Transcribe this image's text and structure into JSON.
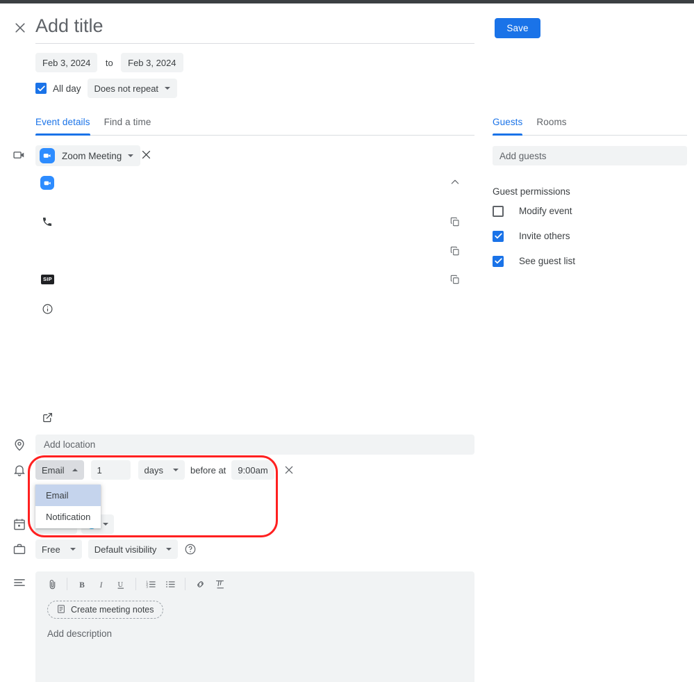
{
  "header": {
    "close_icon": "close-icon",
    "title_placeholder": "Add title",
    "title_value": "",
    "save_label": "Save"
  },
  "schedule": {
    "start_date": "Feb 3, 2024",
    "to_label": "to",
    "end_date": "Feb 3, 2024",
    "all_day_label": "All day",
    "all_day_checked": true,
    "repeat_value": "Does not repeat"
  },
  "tabs": {
    "left": [
      {
        "label": "Event details",
        "active": true
      },
      {
        "label": "Find a time",
        "active": false
      }
    ],
    "right": [
      {
        "label": "Guests",
        "active": true
      },
      {
        "label": "Rooms",
        "active": false
      }
    ]
  },
  "conference": {
    "rail_icon": "video-camera-icon",
    "provider_label": "Zoom Meeting",
    "provider_icon": "zoom-icon",
    "remove_icon": "close-icon",
    "collapse_icon": "chevron-up-icon",
    "rows": [
      {
        "icon": "zoom-icon",
        "text": ""
      },
      {
        "icon": "phone-icon",
        "text": "",
        "copy_icon": "copy-icon"
      },
      {
        "icon": "",
        "text": "",
        "copy_icon": "copy-icon"
      },
      {
        "icon": "sip-icon",
        "badge": "SIP",
        "text": "",
        "copy_icon": "copy-icon"
      },
      {
        "icon": "info-icon",
        "text": ""
      },
      {
        "icon": "external-link-icon",
        "text": ""
      }
    ]
  },
  "location": {
    "rail_icon": "location-pin-icon",
    "placeholder": "Add location",
    "value": ""
  },
  "notification": {
    "rail_icon": "bell-icon",
    "method": "Email",
    "method_caret": "caret-up-icon",
    "amount": "1",
    "unit": "days",
    "before_at_label": "before at",
    "time": "9:00am",
    "remove_icon": "close-icon",
    "dropdown_open": true,
    "dropdown_options": [
      {
        "label": "Email",
        "selected": true
      },
      {
        "label": "Notification",
        "selected": false
      }
    ]
  },
  "calendar_row": {
    "rail_icon": "calendar-icon",
    "calendar_value": "",
    "color_dot": "#039be5"
  },
  "availability": {
    "rail_icon": "briefcase-icon",
    "busy_value": "Free",
    "visibility_value": "Default visibility",
    "help_icon": "help-circle-icon"
  },
  "description": {
    "rail_icon": "description-lines-icon",
    "toolbar": [
      {
        "name": "attach-icon",
        "glyph": "attach"
      },
      {
        "name": "bold-icon",
        "glyph": "B"
      },
      {
        "name": "italic-icon",
        "glyph": "I"
      },
      {
        "name": "underline-icon",
        "glyph": "U"
      },
      {
        "name": "numbered-list-icon",
        "glyph": "ol"
      },
      {
        "name": "bulleted-list-icon",
        "glyph": "ul"
      },
      {
        "name": "link-icon",
        "glyph": "link"
      },
      {
        "name": "clear-formatting-icon",
        "glyph": "clear"
      }
    ],
    "meeting_notes_label": "Create meeting notes",
    "meeting_notes_icon": "document-icon",
    "placeholder": "Add description",
    "value": ""
  },
  "guests": {
    "add_guests_placeholder": "Add guests",
    "permissions_title": "Guest permissions",
    "permissions": [
      {
        "label": "Modify event",
        "checked": false
      },
      {
        "label": "Invite others",
        "checked": true
      },
      {
        "label": "See guest list",
        "checked": true
      }
    ]
  },
  "annotation": {
    "color": "#ff2020",
    "shape": "rounded-rectangle-highlight"
  },
  "colors": {
    "accent": "#1a73e8",
    "chip_bg": "#f1f3f4",
    "chip_active_bg": "#dadce0",
    "zoom_blue": "#2d8cff",
    "dropdown_selected_bg": "#c5d4ed",
    "text_primary": "#3c4043",
    "text_secondary": "#5f6368"
  }
}
